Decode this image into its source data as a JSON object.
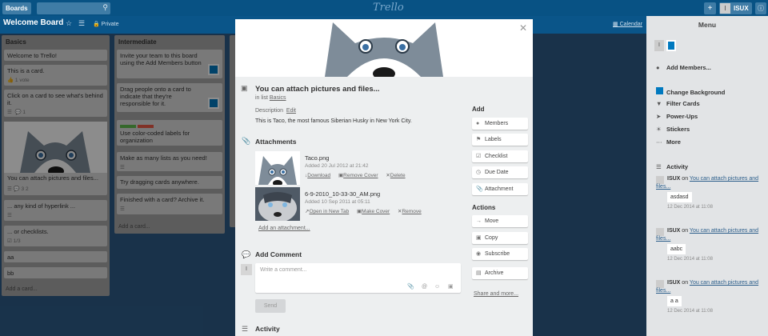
{
  "topbar": {
    "boards_label": "Boards",
    "logo": "Trello",
    "user_avatar": "I",
    "user_name": "ISUX",
    "search_icon": "search-icon",
    "plus_icon": "plus-icon",
    "info_icon": "info-icon"
  },
  "board": {
    "title": "Welcome Board",
    "visibility": "Private",
    "calendar": "Calendar"
  },
  "lists": [
    {
      "title": "Basics",
      "cards": [
        {
          "text": "Welcome to Trello!"
        },
        {
          "text": "This is a card.",
          "meta": "1 vote"
        },
        {
          "text": "Click on a card to see what's behind it.",
          "meta": "1"
        },
        {
          "text": "You can attach pictures and files...",
          "meta": "3   2"
        },
        {
          "text": "... any kind of hyperlink ..."
        },
        {
          "text": "... or checklists.",
          "meta": "1/3"
        },
        {
          "text": "aa"
        },
        {
          "text": "bb"
        }
      ],
      "add": "Add a card..."
    },
    {
      "title": "Intermediate",
      "cards": [
        {
          "text": "Invite your team to this board using the Add Members button"
        },
        {
          "text": "Drag people onto a card to indicate that they're responsible for it."
        },
        {
          "text": "Use color-coded labels for organization"
        },
        {
          "text": "Make as many lists as you need!"
        },
        {
          "text": "Try dragging cards anywhere."
        },
        {
          "text": "Finished with a card? Archive it."
        }
      ],
      "add": "Add a card..."
    }
  ],
  "modal": {
    "title": "You can attach pictures and files...",
    "in_list_prefix": "in list",
    "in_list": "Basics",
    "description_label": "Description",
    "description_edit": "Edit",
    "description": "This is Taco, the most famous Siberian Husky in New York City.",
    "attachments_header": "Attachments",
    "attachments": [
      {
        "name": "Taco.png",
        "added": "Added 20 Jul 2012 at 21:42",
        "actions": [
          "Download",
          "Remove Cover",
          "Delete"
        ]
      },
      {
        "name": "6-9-2010_10-33-30_AM.png",
        "added": "Added 10 Sep 2011 at 05:11",
        "actions": [
          "Open in New Tab",
          "Make Cover",
          "Remove"
        ]
      }
    ],
    "add_attachment": "Add an attachment...",
    "add_comment_header": "Add Comment",
    "comment_avatar": "I",
    "comment_placeholder": "Write a comment...",
    "send": "Send",
    "activity_header": "Activity",
    "add_header": "Add",
    "add_buttons": [
      "Members",
      "Labels",
      "Checklist",
      "Due Date",
      "Attachment"
    ],
    "actions_header": "Actions",
    "action_buttons": [
      "Move",
      "Copy",
      "Subscribe",
      "Archive"
    ],
    "share": "Share and more..."
  },
  "menu": {
    "title": "Menu",
    "avatar": "I",
    "add_members": "Add Members...",
    "items": [
      "Change Background",
      "Filter Cards",
      "Power-Ups",
      "Stickers",
      "More"
    ],
    "activity_header": "Activity",
    "activities": [
      {
        "user": "ISUX",
        "on": "on",
        "card": "You can attach pictures and files...",
        "comment": "asdasd",
        "date": "12 Dec 2014 at 11:08"
      },
      {
        "user": "ISUX",
        "on": "on",
        "card": "You can attach pictures and files...",
        "comment": "aabc",
        "date": "12 Dec 2014 at 11:08"
      },
      {
        "user": "ISUX",
        "on": "on",
        "card": "You can attach pictures and files...",
        "comment": "a a",
        "date": "12 Dec 2014 at 11:08"
      }
    ]
  },
  "colors": {
    "topbar": "#085284",
    "board_bg": "#2e5c88",
    "label_green": "#61bd4f",
    "label_red": "#eb5a46",
    "change_bg_swatch": "#0079bf"
  }
}
